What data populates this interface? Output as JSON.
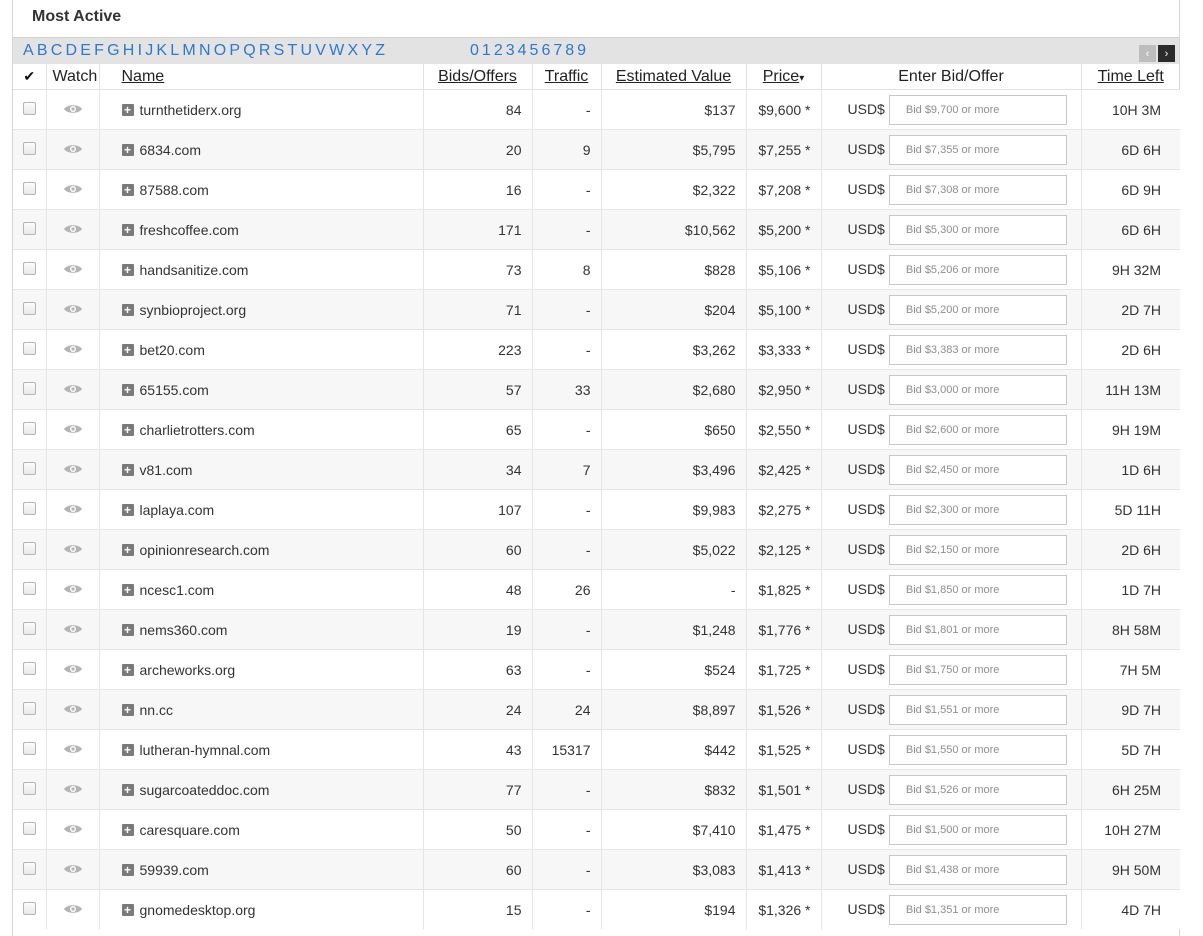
{
  "panel": {
    "title": "Most Active"
  },
  "letters": [
    "A",
    "B",
    "C",
    "D",
    "E",
    "F",
    "G",
    "H",
    "I",
    "J",
    "K",
    "L",
    "M",
    "N",
    "O",
    "P",
    "Q",
    "R",
    "S",
    "T",
    "U",
    "V",
    "W",
    "X",
    "Y",
    "Z"
  ],
  "digits": [
    "0",
    "1",
    "2",
    "3",
    "4",
    "5",
    "6",
    "7",
    "8",
    "9"
  ],
  "pager": {
    "prev_icon": "chevron-left-icon",
    "next_icon": "chevron-right-icon",
    "prev": "‹",
    "next": "›"
  },
  "header": {
    "check": "✔",
    "watch": "Watch",
    "name": "Name",
    "bids": "Bids/Offers",
    "traffic": "Traffic",
    "estimated": "Estimated Value",
    "price": "Price",
    "price_arrow": "▾",
    "bid": "Enter Bid/Offer",
    "time": "Time Left"
  },
  "currency": "USD$",
  "rows": [
    {
      "name": "turnthetiderx.org",
      "bids": "84",
      "traffic": "-",
      "est": "$137",
      "price": "$9,600 *",
      "placeholder": "Bid $9,700 or more",
      "time": "10H 3M"
    },
    {
      "name": "6834.com",
      "bids": "20",
      "traffic": "9",
      "est": "$5,795",
      "price": "$7,255 *",
      "placeholder": "Bid $7,355 or more",
      "time": "6D 6H"
    },
    {
      "name": "87588.com",
      "bids": "16",
      "traffic": "-",
      "est": "$2,322",
      "price": "$7,208 *",
      "placeholder": "Bid $7,308 or more",
      "time": "6D 9H"
    },
    {
      "name": "freshcoffee.com",
      "bids": "171",
      "traffic": "-",
      "est": "$10,562",
      "price": "$5,200 *",
      "placeholder": "Bid $5,300 or more",
      "time": "6D 6H"
    },
    {
      "name": "handsanitize.com",
      "bids": "73",
      "traffic": "8",
      "est": "$828",
      "price": "$5,106 *",
      "placeholder": "Bid $5,206 or more",
      "time": "9H 32M"
    },
    {
      "name": "synbioproject.org",
      "bids": "71",
      "traffic": "-",
      "est": "$204",
      "price": "$5,100 *",
      "placeholder": "Bid $5,200 or more",
      "time": "2D 7H"
    },
    {
      "name": "bet20.com",
      "bids": "223",
      "traffic": "-",
      "est": "$3,262",
      "price": "$3,333 *",
      "placeholder": "Bid $3,383 or more",
      "time": "2D 6H"
    },
    {
      "name": "65155.com",
      "bids": "57",
      "traffic": "33",
      "est": "$2,680",
      "price": "$2,950 *",
      "placeholder": "Bid $3,000 or more",
      "time": "11H 13M"
    },
    {
      "name": "charlietrotters.com",
      "bids": "65",
      "traffic": "-",
      "est": "$650",
      "price": "$2,550 *",
      "placeholder": "Bid $2,600 or more",
      "time": "9H 19M"
    },
    {
      "name": "v81.com",
      "bids": "34",
      "traffic": "7",
      "est": "$3,496",
      "price": "$2,425 *",
      "placeholder": "Bid $2,450 or more",
      "time": "1D 6H"
    },
    {
      "name": "laplaya.com",
      "bids": "107",
      "traffic": "-",
      "est": "$9,983",
      "price": "$2,275 *",
      "placeholder": "Bid $2,300 or more",
      "time": "5D 11H"
    },
    {
      "name": "opinionresearch.com",
      "bids": "60",
      "traffic": "-",
      "est": "$5,022",
      "price": "$2,125 *",
      "placeholder": "Bid $2,150 or more",
      "time": "2D 6H"
    },
    {
      "name": "ncesc1.com",
      "bids": "48",
      "traffic": "26",
      "est": "-",
      "price": "$1,825 *",
      "placeholder": "Bid $1,850 or more",
      "time": "1D 7H"
    },
    {
      "name": "nems360.com",
      "bids": "19",
      "traffic": "-",
      "est": "$1,248",
      "price": "$1,776 *",
      "placeholder": "Bid $1,801 or more",
      "time": "8H 58M"
    },
    {
      "name": "archeworks.org",
      "bids": "63",
      "traffic": "-",
      "est": "$524",
      "price": "$1,725 *",
      "placeholder": "Bid $1,750 or more",
      "time": "7H 5M"
    },
    {
      "name": "nn.cc",
      "bids": "24",
      "traffic": "24",
      "est": "$8,897",
      "price": "$1,526 *",
      "placeholder": "Bid $1,551 or more",
      "time": "9D 7H"
    },
    {
      "name": "lutheran-hymnal.com",
      "bids": "43",
      "traffic": "15317",
      "est": "$442",
      "price": "$1,525 *",
      "placeholder": "Bid $1,550 or more",
      "time": "5D 7H"
    },
    {
      "name": "sugarcoateddoc.com",
      "bids": "77",
      "traffic": "-",
      "est": "$832",
      "price": "$1,501 *",
      "placeholder": "Bid $1,526 or more",
      "time": "6H 25M"
    },
    {
      "name": "caresquare.com",
      "bids": "50",
      "traffic": "-",
      "est": "$7,410",
      "price": "$1,475 *",
      "placeholder": "Bid $1,500 or more",
      "time": "10H 27M"
    },
    {
      "name": "59939.com",
      "bids": "60",
      "traffic": "-",
      "est": "$3,083",
      "price": "$1,413 *",
      "placeholder": "Bid $1,438 or more",
      "time": "9H 50M"
    },
    {
      "name": "gnomedesktop.org",
      "bids": "15",
      "traffic": "-",
      "est": "$194",
      "price": "$1,326 *",
      "placeholder": "Bid $1,351 or more",
      "time": "4D 7H"
    }
  ]
}
